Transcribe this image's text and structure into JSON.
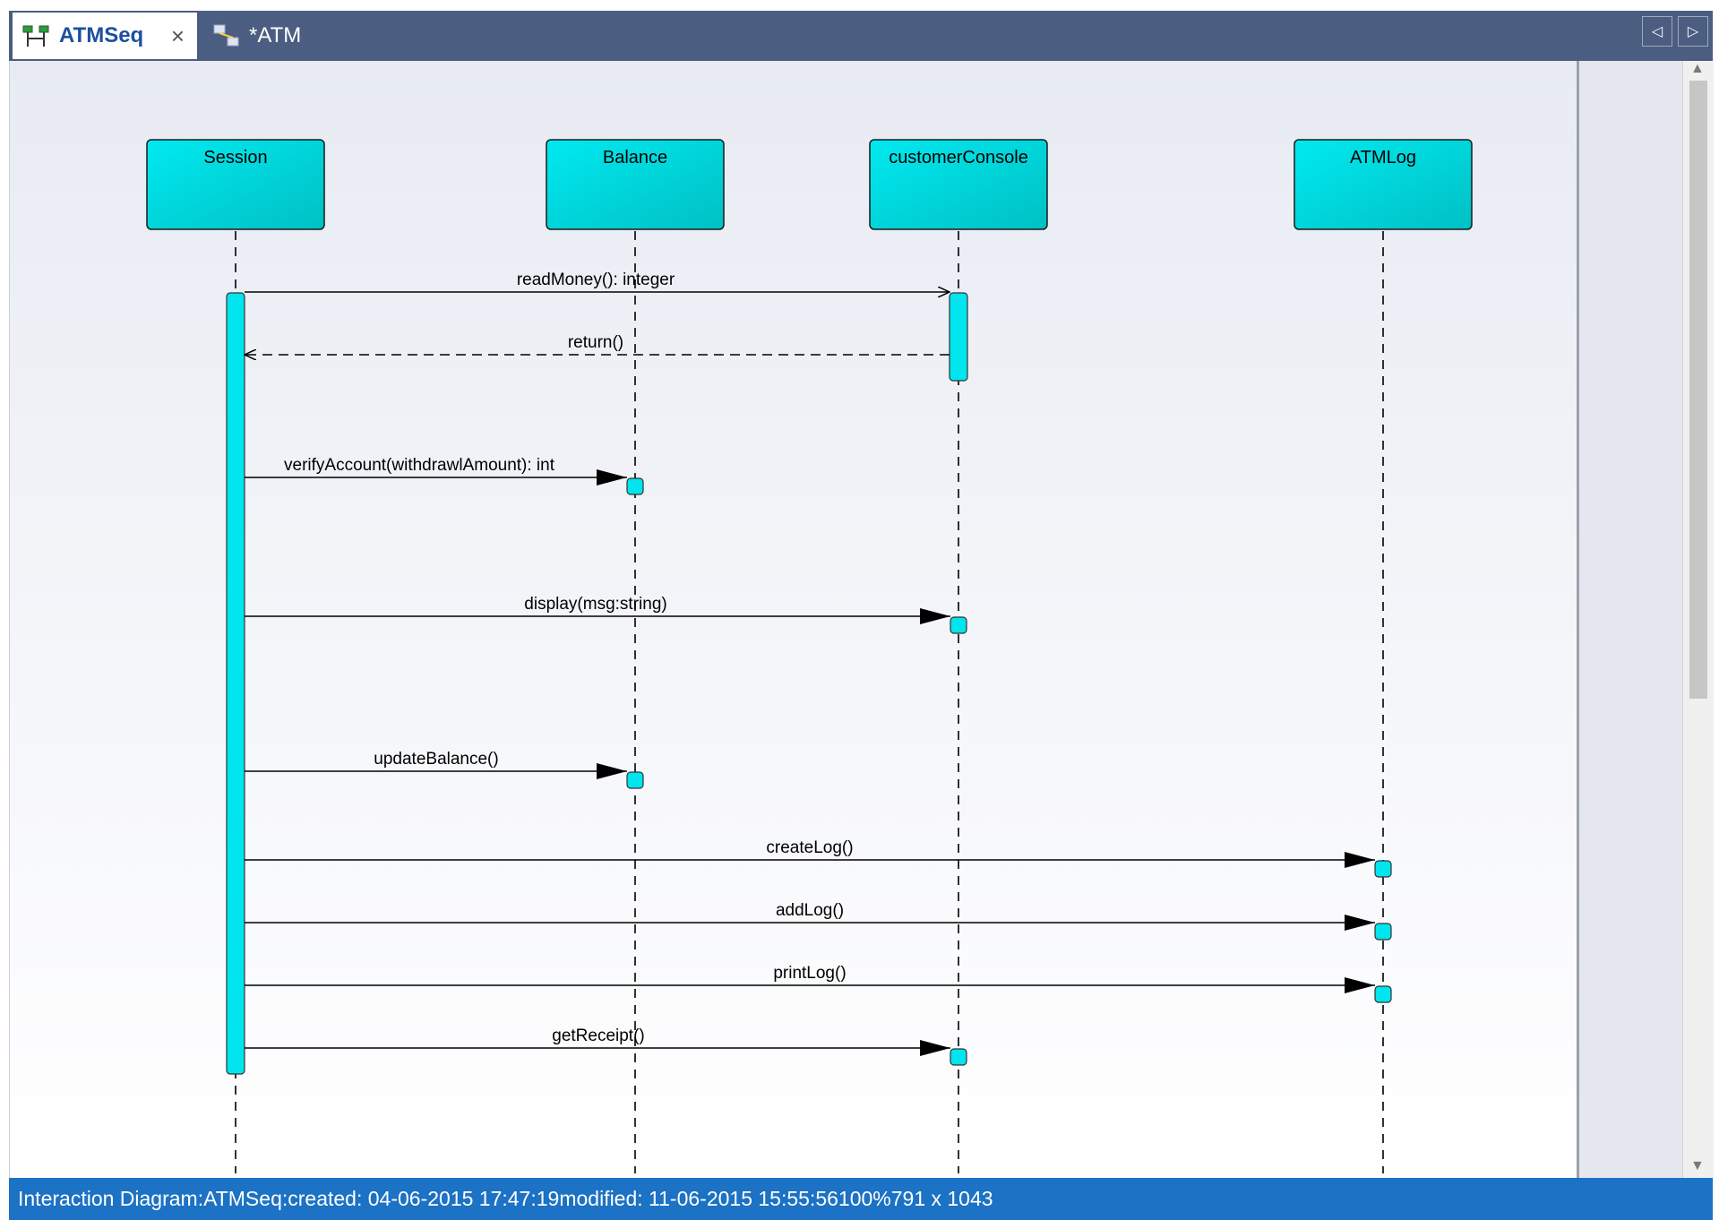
{
  "tabs": [
    {
      "label": "ATMSeq",
      "active": true,
      "icon": "sequence-diagram-icon"
    },
    {
      "label": "*ATM",
      "active": false,
      "icon": "class-diagram-icon"
    }
  ],
  "tab_close": "×",
  "nav": {
    "prev": "◁",
    "next": "▷"
  },
  "scroll": {
    "up": "▲",
    "down": "▼"
  },
  "lifelines": [
    "Session",
    "Balance",
    "customerConsole",
    "ATMLog"
  ],
  "messages": [
    {
      "label": "readMoney(): integer",
      "from": "Session",
      "to": "customerConsole",
      "kind": "call"
    },
    {
      "label": "return()",
      "from": "customerConsole",
      "to": "Session",
      "kind": "return"
    },
    {
      "label": "verifyAccount(withdrawlAmount): int",
      "from": "Session",
      "to": "Balance",
      "kind": "call"
    },
    {
      "label": "display(msg:string)",
      "from": "Session",
      "to": "customerConsole",
      "kind": "call"
    },
    {
      "label": "updateBalance()",
      "from": "Session",
      "to": "Balance",
      "kind": "call"
    },
    {
      "label": "createLog()",
      "from": "Session",
      "to": "ATMLog",
      "kind": "call"
    },
    {
      "label": "addLog()",
      "from": "Session",
      "to": "ATMLog",
      "kind": "call"
    },
    {
      "label": "printLog()",
      "from": "Session",
      "to": "ATMLog",
      "kind": "call"
    },
    {
      "label": "getReceipt()",
      "from": "Session",
      "to": "customerConsole",
      "kind": "call"
    }
  ],
  "colors": {
    "lifeline_fill": "#00dada",
    "activation_fill": "#00e5ee",
    "tab_strip": "#4b5d80",
    "status_bar": "#1c72c4"
  },
  "status": {
    "diagram": "Interaction Diagram:ATMSeq:",
    "created": "created: 04-06-2015 17:47:19",
    "modified": "modified: 11-06-2015 15:55:56",
    "zoom": "100%",
    "size": "791 x 1043"
  }
}
